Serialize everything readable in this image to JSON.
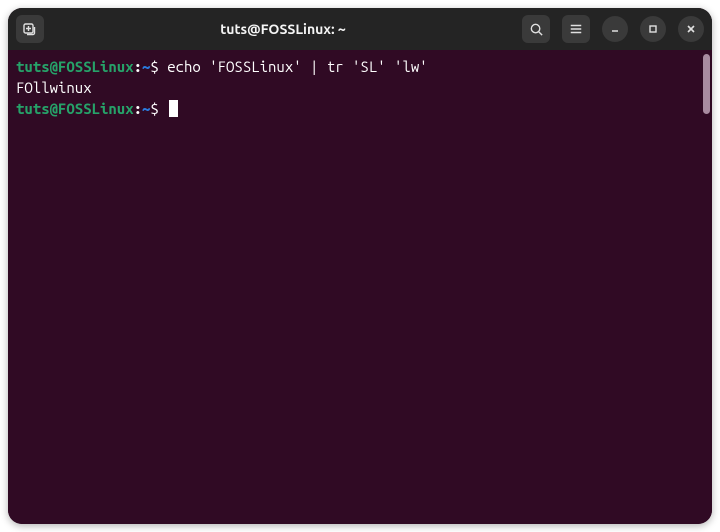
{
  "window": {
    "title": "tuts@FOSSLinux: ~"
  },
  "terminal": {
    "lines": [
      {
        "type": "prompt",
        "user_host": "tuts@FOSSLinux",
        "colon": ":",
        "path": "~",
        "dollar": "$ ",
        "command": "echo 'FOSSLinux' | tr 'SL' 'lw'"
      },
      {
        "type": "output",
        "text": "FOllwinux"
      },
      {
        "type": "prompt",
        "user_host": "tuts@FOSSLinux",
        "colon": ":",
        "path": "~",
        "dollar": "$ ",
        "command": "",
        "cursor": true
      }
    ]
  }
}
